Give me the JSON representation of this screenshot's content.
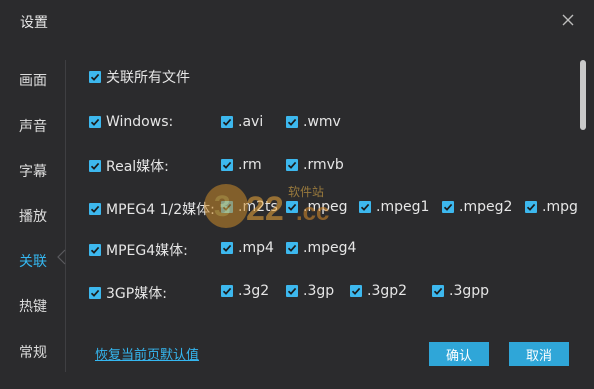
{
  "dialog": {
    "title": "设置"
  },
  "nav": {
    "items": [
      {
        "label": "画面",
        "active": false
      },
      {
        "label": "声音",
        "active": false
      },
      {
        "label": "字幕",
        "active": false
      },
      {
        "label": "播放",
        "active": false
      },
      {
        "label": "关联",
        "active": true
      },
      {
        "label": "热键",
        "active": false
      },
      {
        "label": "常规",
        "active": false
      }
    ]
  },
  "assoc": {
    "all_files_label": "关联所有文件",
    "groups": {
      "windows": {
        "label": "Windows:",
        "exts": [
          ".avi",
          ".wmv"
        ]
      },
      "real": {
        "label": "Real媒体:",
        "exts": [
          ".rm",
          ".rmvb"
        ]
      },
      "mpeg412": {
        "label": "MPEG4 1/2媒体:",
        "exts": [
          ".m2ts",
          ".mpeg",
          ".mpeg1",
          ".mpeg2",
          ".mpg"
        ]
      },
      "mpeg4": {
        "label": "MPEG4媒体:",
        "exts": [
          ".mp4",
          ".mpeg4"
        ]
      },
      "threegp": {
        "label": "3GP媒体:",
        "exts": [
          ".3g2",
          ".3gp",
          ".3gp2",
          ".3gpp"
        ]
      }
    }
  },
  "footer": {
    "restore_label": "恢复当前页默认值",
    "ok_label": "确认",
    "cancel_label": "取消"
  },
  "watermark": {
    "text": "软件站",
    "brand": "322",
    "domain": ".cc"
  },
  "colors": {
    "accent": "#35b7f0",
    "checkbox": "#3db8ee",
    "button": "#2fa6d8",
    "background": "#2b2b2d"
  }
}
